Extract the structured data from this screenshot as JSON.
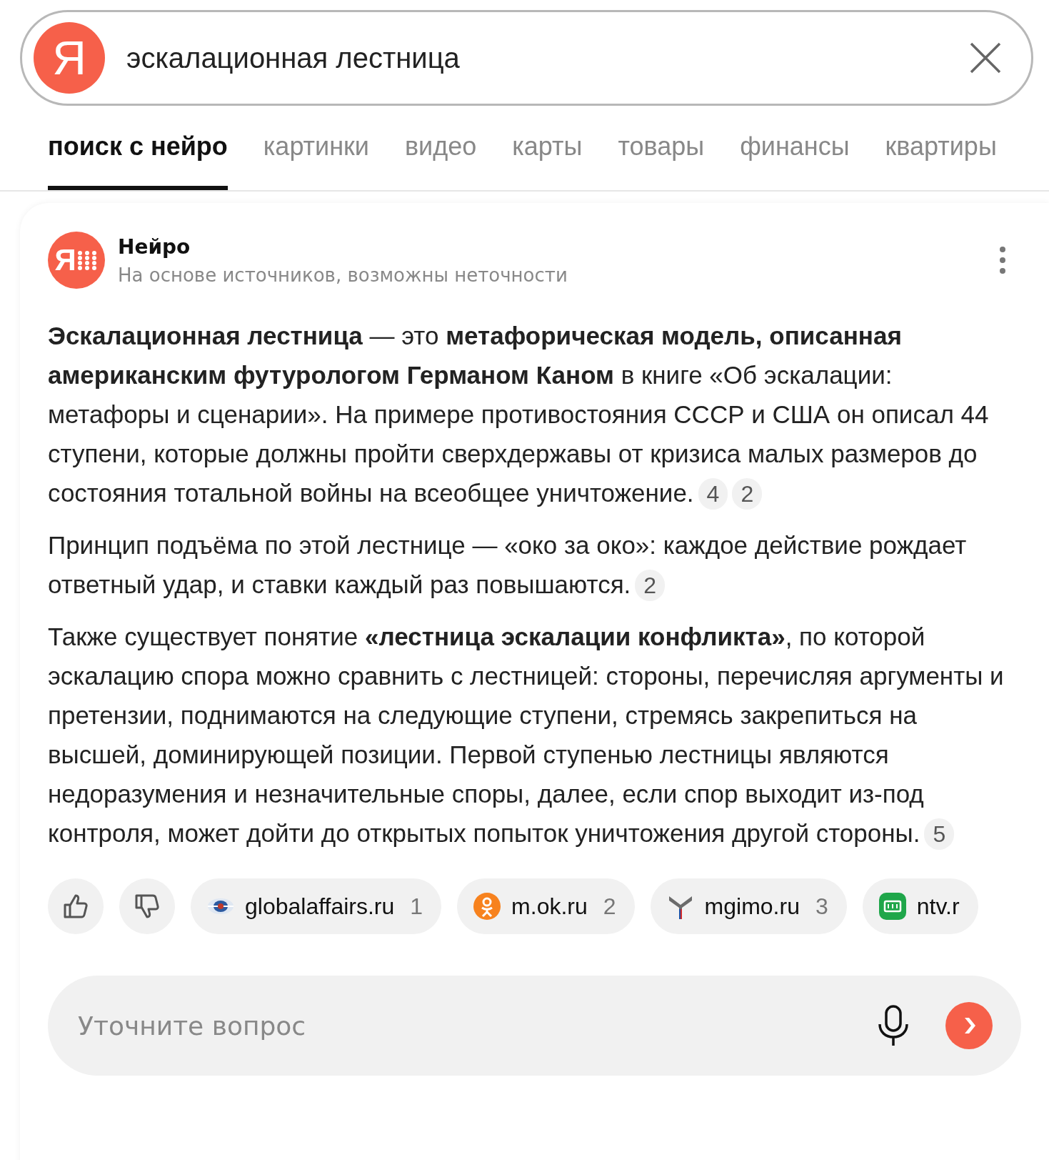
{
  "search": {
    "logo": "Я",
    "query": "эскалационная лестница"
  },
  "tabs": [
    {
      "label": "поиск с нейро",
      "selected": true
    },
    {
      "label": "картинки",
      "selected": false
    },
    {
      "label": "видео",
      "selected": false
    },
    {
      "label": "карты",
      "selected": false
    },
    {
      "label": "товары",
      "selected": false
    },
    {
      "label": "финансы",
      "selected": false
    },
    {
      "label": "квартиры",
      "selected": false
    }
  ],
  "answer": {
    "logo": "Я",
    "title": "Нейро",
    "subtitle": "На основе источников, возможны неточности",
    "paragraphs": [
      {
        "text": "**Эскалационная лестница** — это **метафорическая модель, описанная американским футурологом Германом Каном** в книге «Об эскалации: метафоры и сценарии». На примере противостояния СССР и США он описал 44 ступени, которые должны пройти сверхдержавы от кризиса малых размеров до состояния тотальной войны на всеобщее уничтожение.",
        "citations": [
          "4",
          "2"
        ]
      },
      {
        "text": "Принцип подъёма по этой лестнице — «око за око»: каждое действие рождает ответный удар, и ставки каждый раз повышаются.",
        "citations": [
          "2"
        ]
      },
      {
        "text": "Также существует понятие **«лестница эскалации конфликта»**, по которой эскалацию спора можно сравнить с лестницей: стороны, перечисляя аргументы и претензии, поднимаются на следующие ступени, стремясь закрепиться на высшей, доминирующей позиции. Первой ступенью лестницы являются недоразумения и незначительные споры, далее, если спор выходит из-под контроля, может дойти до открытых попыток уничтожения другой стороны.",
        "citations": [
          "5"
        ]
      }
    ],
    "sources": [
      {
        "kind": "globe",
        "name": "globalaffairs.ru",
        "number": "1"
      },
      {
        "kind": "ok",
        "name": "m.ok.ru",
        "number": "2"
      },
      {
        "kind": "mgimo",
        "name": "mgimo.ru",
        "number": "3"
      },
      {
        "kind": "ntv",
        "name": "ntv.r"
      }
    ],
    "followup": {
      "placeholder": "Уточните вопрос"
    }
  }
}
